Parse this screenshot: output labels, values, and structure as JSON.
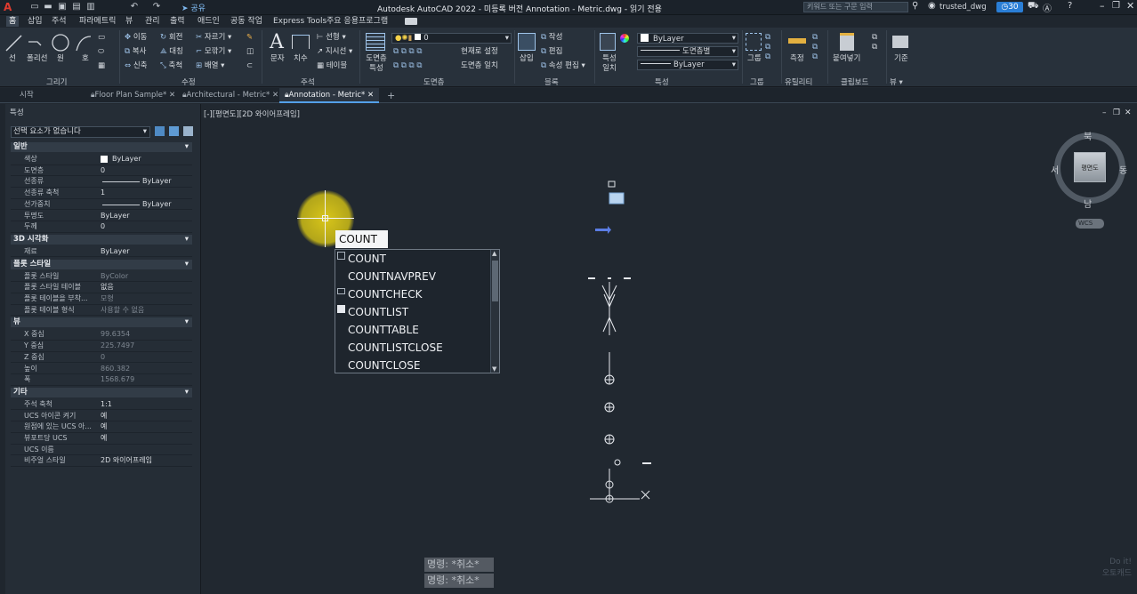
{
  "app": {
    "logo": "A",
    "title": "Autodesk AutoCAD 2022 - 미등록 버전    Annotation - Metric.dwg - 읽기 전용",
    "share_label": "공유",
    "search_placeholder": "키워드 또는 구문 입력",
    "user": "trusted_dwg",
    "trial_days": "30"
  },
  "menu": [
    "홈",
    "삽입",
    "주석",
    "파라메트릭",
    "뷰",
    "관리",
    "출력",
    "애드인",
    "공동 작업",
    "Express Tools",
    "주요 응용프로그램"
  ],
  "ribbon": {
    "draw": {
      "line": "선",
      "polyline": "폴리선",
      "circle": "원",
      "arc": "호",
      "panel": "그리기"
    },
    "modify": {
      "move": "이동",
      "rotate": "회전",
      "trim": "자르기",
      "copy": "복사",
      "mirror": "대칭",
      "fillet": "모깎기",
      "stretch": "신축",
      "scale": "축척",
      "array": "배열",
      "panel": "수정"
    },
    "annotation": {
      "text": "문자",
      "dimension": "치수",
      "linear": "선형",
      "leader": "지시선",
      "table": "테이블",
      "panel": "주석"
    },
    "layers": {
      "layer_props": "도면층 특성",
      "current_layer": "0",
      "make_current": "현재로 설정",
      "match_layer": "도면층 일치",
      "panel": "도면층"
    },
    "block": {
      "insert": "삽입",
      "create": "작성",
      "edit": "편집",
      "edit_attributes": "속성 편집",
      "panel": "블록"
    },
    "properties": {
      "match": "특성 일치",
      "color": "ByLayer",
      "linetype": "도면층별",
      "lineweight": "ByLayer",
      "panel": "특성"
    },
    "groups": {
      "group": "그룹",
      "panel": "그룹"
    },
    "utilities": {
      "measure": "측정",
      "panel": "유틸리티"
    },
    "clipboard": {
      "paste": "붙여넣기",
      "panel": "클립보드"
    },
    "view": {
      "base": "기준",
      "panel": "뷰"
    }
  },
  "tabs": [
    {
      "label": "시작"
    },
    {
      "label": "Floor Plan Sample*"
    },
    {
      "label": "Architectural - Metric*"
    },
    {
      "label": "Annotation - Metric*"
    }
  ],
  "properties_panel": {
    "title": "특성",
    "selection": "선택 요소가 없습니다",
    "sections": [
      {
        "title": "일반",
        "rows": [
          {
            "k": "색상",
            "v": "ByLayer"
          },
          {
            "k": "도면층",
            "v": "0"
          },
          {
            "k": "선종류",
            "v": "ByLayer"
          },
          {
            "k": "선종류 축척",
            "v": "1"
          },
          {
            "k": "선가중치",
            "v": "ByLayer"
          },
          {
            "k": "투명도",
            "v": "ByLayer"
          },
          {
            "k": "두께",
            "v": "0"
          }
        ]
      },
      {
        "title": "3D 시각화",
        "rows": [
          {
            "k": "재료",
            "v": "ByLayer"
          }
        ]
      },
      {
        "title": "플롯 스타일",
        "rows": [
          {
            "k": "플롯 스타일",
            "v": "ByColor"
          },
          {
            "k": "플롯 스타일 테이블",
            "v": "없음"
          },
          {
            "k": "플롯 테이블을 부착...",
            "v": "모형"
          },
          {
            "k": "플롯 테이블 형식",
            "v": "사용할 수 없음"
          }
        ]
      },
      {
        "title": "뷰",
        "rows": [
          {
            "k": "X 중심",
            "v": "99.6354"
          },
          {
            "k": "Y 중심",
            "v": "225.7497"
          },
          {
            "k": "Z 중심",
            "v": "0"
          },
          {
            "k": "높이",
            "v": "860.382"
          },
          {
            "k": "폭",
            "v": "1568.679"
          }
        ]
      },
      {
        "title": "기타",
        "rows": [
          {
            "k": "주석 축척",
            "v": "1:1"
          },
          {
            "k": "UCS 아이콘 켜기",
            "v": "예"
          },
          {
            "k": "원점에 있는 UCS 아...",
            "v": "예"
          },
          {
            "k": "뷰포트당 UCS",
            "v": "예"
          },
          {
            "k": "UCS 이름",
            "v": ""
          },
          {
            "k": "비주얼 스타일",
            "v": "2D 와이어프레임"
          }
        ]
      }
    ]
  },
  "viewport": {
    "label": "[-][평면도][2D 와이어프레임]",
    "viewcube": {
      "n": "북",
      "s": "남",
      "e": "동",
      "w": "서",
      "face": "평면도",
      "ucs": "WCS"
    }
  },
  "autocomplete": {
    "input": "COUNT",
    "items": [
      "COUNT",
      "COUNTNAVPREV",
      "COUNTCHECK",
      "COUNTLIST",
      "COUNTTABLE",
      "COUNTLISTCLOSE",
      "COUNTCLOSE"
    ]
  },
  "command_history": [
    "명령: *취소*",
    "명령: *취소*"
  ],
  "watermark": "Do it!\n오토캐드"
}
